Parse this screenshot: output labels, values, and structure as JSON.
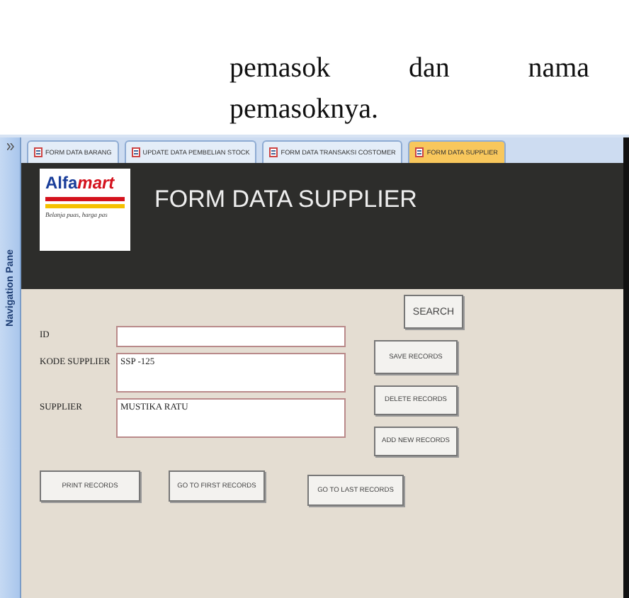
{
  "document": {
    "paragraph_lines": [
      "pemasok dan nama",
      "pemasoknya."
    ]
  },
  "navigation_pane": {
    "label": "Navigation Pane"
  },
  "tabs": [
    {
      "label": "FORM DATA BARANG",
      "selected": false
    },
    {
      "label": "UPDATE DATA PEMBELIAN STOCK",
      "selected": false
    },
    {
      "label": "FORM DATA TRANSAKSI COSTOMER",
      "selected": false
    },
    {
      "label": "FORM DATA SUPPLIER",
      "selected": true
    }
  ],
  "header": {
    "logo": {
      "name_parts": [
        "Alfa",
        "mart"
      ],
      "tagline": "Belanja puas, harga pas"
    },
    "title": "FORM DATA SUPPLIER"
  },
  "fields": [
    {
      "label": "ID"
    },
    {
      "label": "KODE SUPPLIER",
      "value": "SSP -125"
    },
    {
      "label": "SUPPLIER",
      "value": "MUSTIKA RATU"
    }
  ],
  "side_buttons": [
    "SAVE RECORDS",
    "DELETE RECORDS",
    "ADD NEW RECORDS"
  ],
  "search_button": "SEARCH",
  "bottom_buttons": [
    "PRINT RECORDS",
    "GO TO FIRST RECORDS",
    "GO TO LAST RECORDS"
  ]
}
